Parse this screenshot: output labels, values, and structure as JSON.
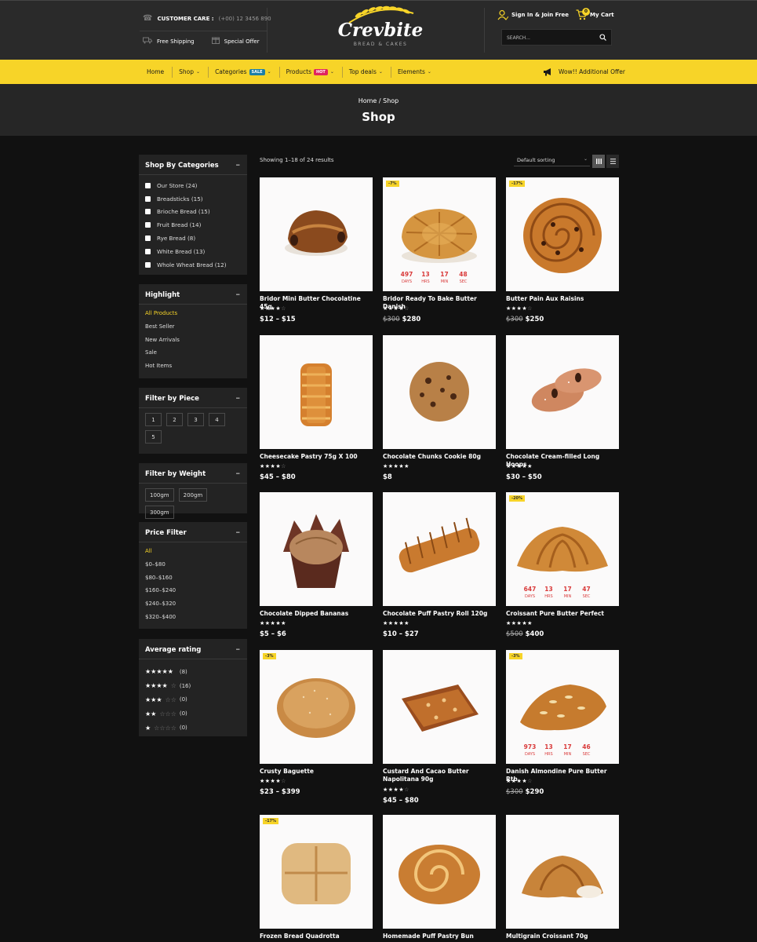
{
  "header": {
    "customer_care_label": "CUSTOMER CARE :",
    "customer_care_phone": "(+00) 12 3456 890",
    "free_shipping": "Free Shipping",
    "special_offer": "Special Offer",
    "logo_name": "Crevbite",
    "logo_tagline": "BREAD & CAKES",
    "sign_in": "Sign In & Join Free",
    "cart_label": "My Cart",
    "cart_count": "0",
    "search_placeholder": "SEARCH..."
  },
  "nav": {
    "items": [
      "Home",
      "Shop",
      "Categories",
      "Products",
      "Top deals",
      "Elements"
    ],
    "sale_tag": "SALE",
    "hot_tag": "HOT",
    "offer": "Wow!! Additional Offer"
  },
  "banner": {
    "breadcrumb_home": "Home",
    "breadcrumb_sep": "/",
    "breadcrumb_current": "Shop",
    "title": "Shop"
  },
  "sidebar": {
    "categories_title": "Shop By Categories",
    "categories": [
      {
        "label": "Our Store",
        "count": "(24)"
      },
      {
        "label": "Breadsticks",
        "count": "(15)"
      },
      {
        "label": "Brioche Bread",
        "count": "(15)"
      },
      {
        "label": "Fruit Bread",
        "count": "(14)"
      },
      {
        "label": "Rye Bread",
        "count": "(8)"
      },
      {
        "label": "White Bread",
        "count": "(13)"
      },
      {
        "label": "Whole Wheat Bread",
        "count": "(12)"
      }
    ],
    "highlight_title": "Highlight",
    "highlights": [
      "All Products",
      "Best Seller",
      "New Arrivals",
      "Sale",
      "Hot Items"
    ],
    "piece_title": "Filter by Piece",
    "pieces": [
      "1",
      "2",
      "3",
      "4",
      "5"
    ],
    "weight_title": "Filter by Weight",
    "weights": [
      "100gm",
      "200gm",
      "300gm"
    ],
    "price_title": "Price Filter",
    "prices": [
      "All",
      "$0–$80",
      "$80–$160",
      "$160–$240",
      "$240–$320",
      "$320–$400"
    ],
    "rating_title": "Average rating",
    "ratings": [
      {
        "stars": 5,
        "count": "(8)"
      },
      {
        "stars": 4,
        "count": "(16)"
      },
      {
        "stars": 3,
        "count": "(0)"
      },
      {
        "stars": 2,
        "count": "(0)"
      },
      {
        "stars": 1,
        "count": "(0)"
      }
    ],
    "toggle": "–"
  },
  "toolbar": {
    "showing": "Showing 1–18 of 24 results",
    "sort": "Default sorting"
  },
  "timer_labels": [
    "DAYS",
    "HRS",
    "MIN",
    "SEC"
  ],
  "products": [
    {
      "name": "Bridor Mini Butter Chocolatine 45g",
      "rating": 4,
      "old": "",
      "price": "$12 – $15",
      "badge": "",
      "timer": null,
      "food": "chocolatine"
    },
    {
      "name": "Bridor Ready To Bake Butter Danish",
      "rating": 4,
      "old": "$300",
      "price": "$280",
      "badge": "-7%",
      "timer": [
        "497",
        "13",
        "17",
        "48"
      ],
      "food": "danish"
    },
    {
      "name": "Butter Pain Aux Raisins",
      "rating": 4,
      "old": "$300",
      "price": "$250",
      "badge": "-17%",
      "timer": null,
      "food": "raisin"
    },
    {
      "name": "Cheesecake Pastry 75g X 100",
      "rating": 4,
      "old": "",
      "price": "$45 – $80",
      "badge": "",
      "timer": null,
      "food": "pastry"
    },
    {
      "name": "Chocolate Chunks Cookie 80g",
      "rating": 5,
      "old": "",
      "price": "$8",
      "badge": "",
      "timer": null,
      "food": "cookie"
    },
    {
      "name": "Chocolate Cream-filled Long Hoops",
      "rating": 5,
      "old": "",
      "price": "$30 – $50",
      "badge": "",
      "timer": null,
      "food": "hoops"
    },
    {
      "name": "Chocolate Dipped Bananas",
      "rating": 5,
      "old": "",
      "price": "$5 – $6",
      "badge": "",
      "timer": null,
      "food": "muffin"
    },
    {
      "name": "Chocolate Puff Pastry Roll 120g",
      "rating": 5,
      "old": "",
      "price": "$10 – $27",
      "badge": "",
      "timer": null,
      "food": "roll"
    },
    {
      "name": "Croissant Pure Butter Perfect",
      "rating": 5,
      "old": "$500",
      "price": "$400",
      "badge": "-20%",
      "timer": [
        "647",
        "13",
        "17",
        "47"
      ],
      "food": "croissant"
    },
    {
      "name": "Crusty Baguette",
      "rating": 4,
      "old": "",
      "price": "$23 – $399",
      "badge": "-3%",
      "timer": null,
      "food": "loaf"
    },
    {
      "name": "Custard And Cacao Butter Napolitana 90g",
      "rating": 4,
      "old": "",
      "price": "$45 – $80",
      "badge": "",
      "timer": null,
      "food": "napolitana"
    },
    {
      "name": "Danish Almondine Pure Butter Rtb",
      "rating": 4,
      "old": "$300",
      "price": "$290",
      "badge": "-3%",
      "timer": [
        "973",
        "13",
        "17",
        "46"
      ],
      "food": "almondine"
    },
    {
      "name": "Frozen Bread Quadrotta",
      "rating": 0,
      "old": "",
      "price": "",
      "badge": "-17%",
      "timer": null,
      "food": "quadrotta"
    },
    {
      "name": "Homemade Puff Pastry Bun",
      "rating": 0,
      "old": "",
      "price": "",
      "badge": "",
      "timer": null,
      "food": "bun"
    },
    {
      "name": "Multigrain Croissant 70g",
      "rating": 0,
      "old": "",
      "price": "",
      "badge": "",
      "timer": null,
      "food": "croissant2"
    }
  ],
  "colors": {
    "accent": "#f7d428",
    "background": "#111111",
    "panel": "#232323",
    "timer": "#d93a3a"
  }
}
